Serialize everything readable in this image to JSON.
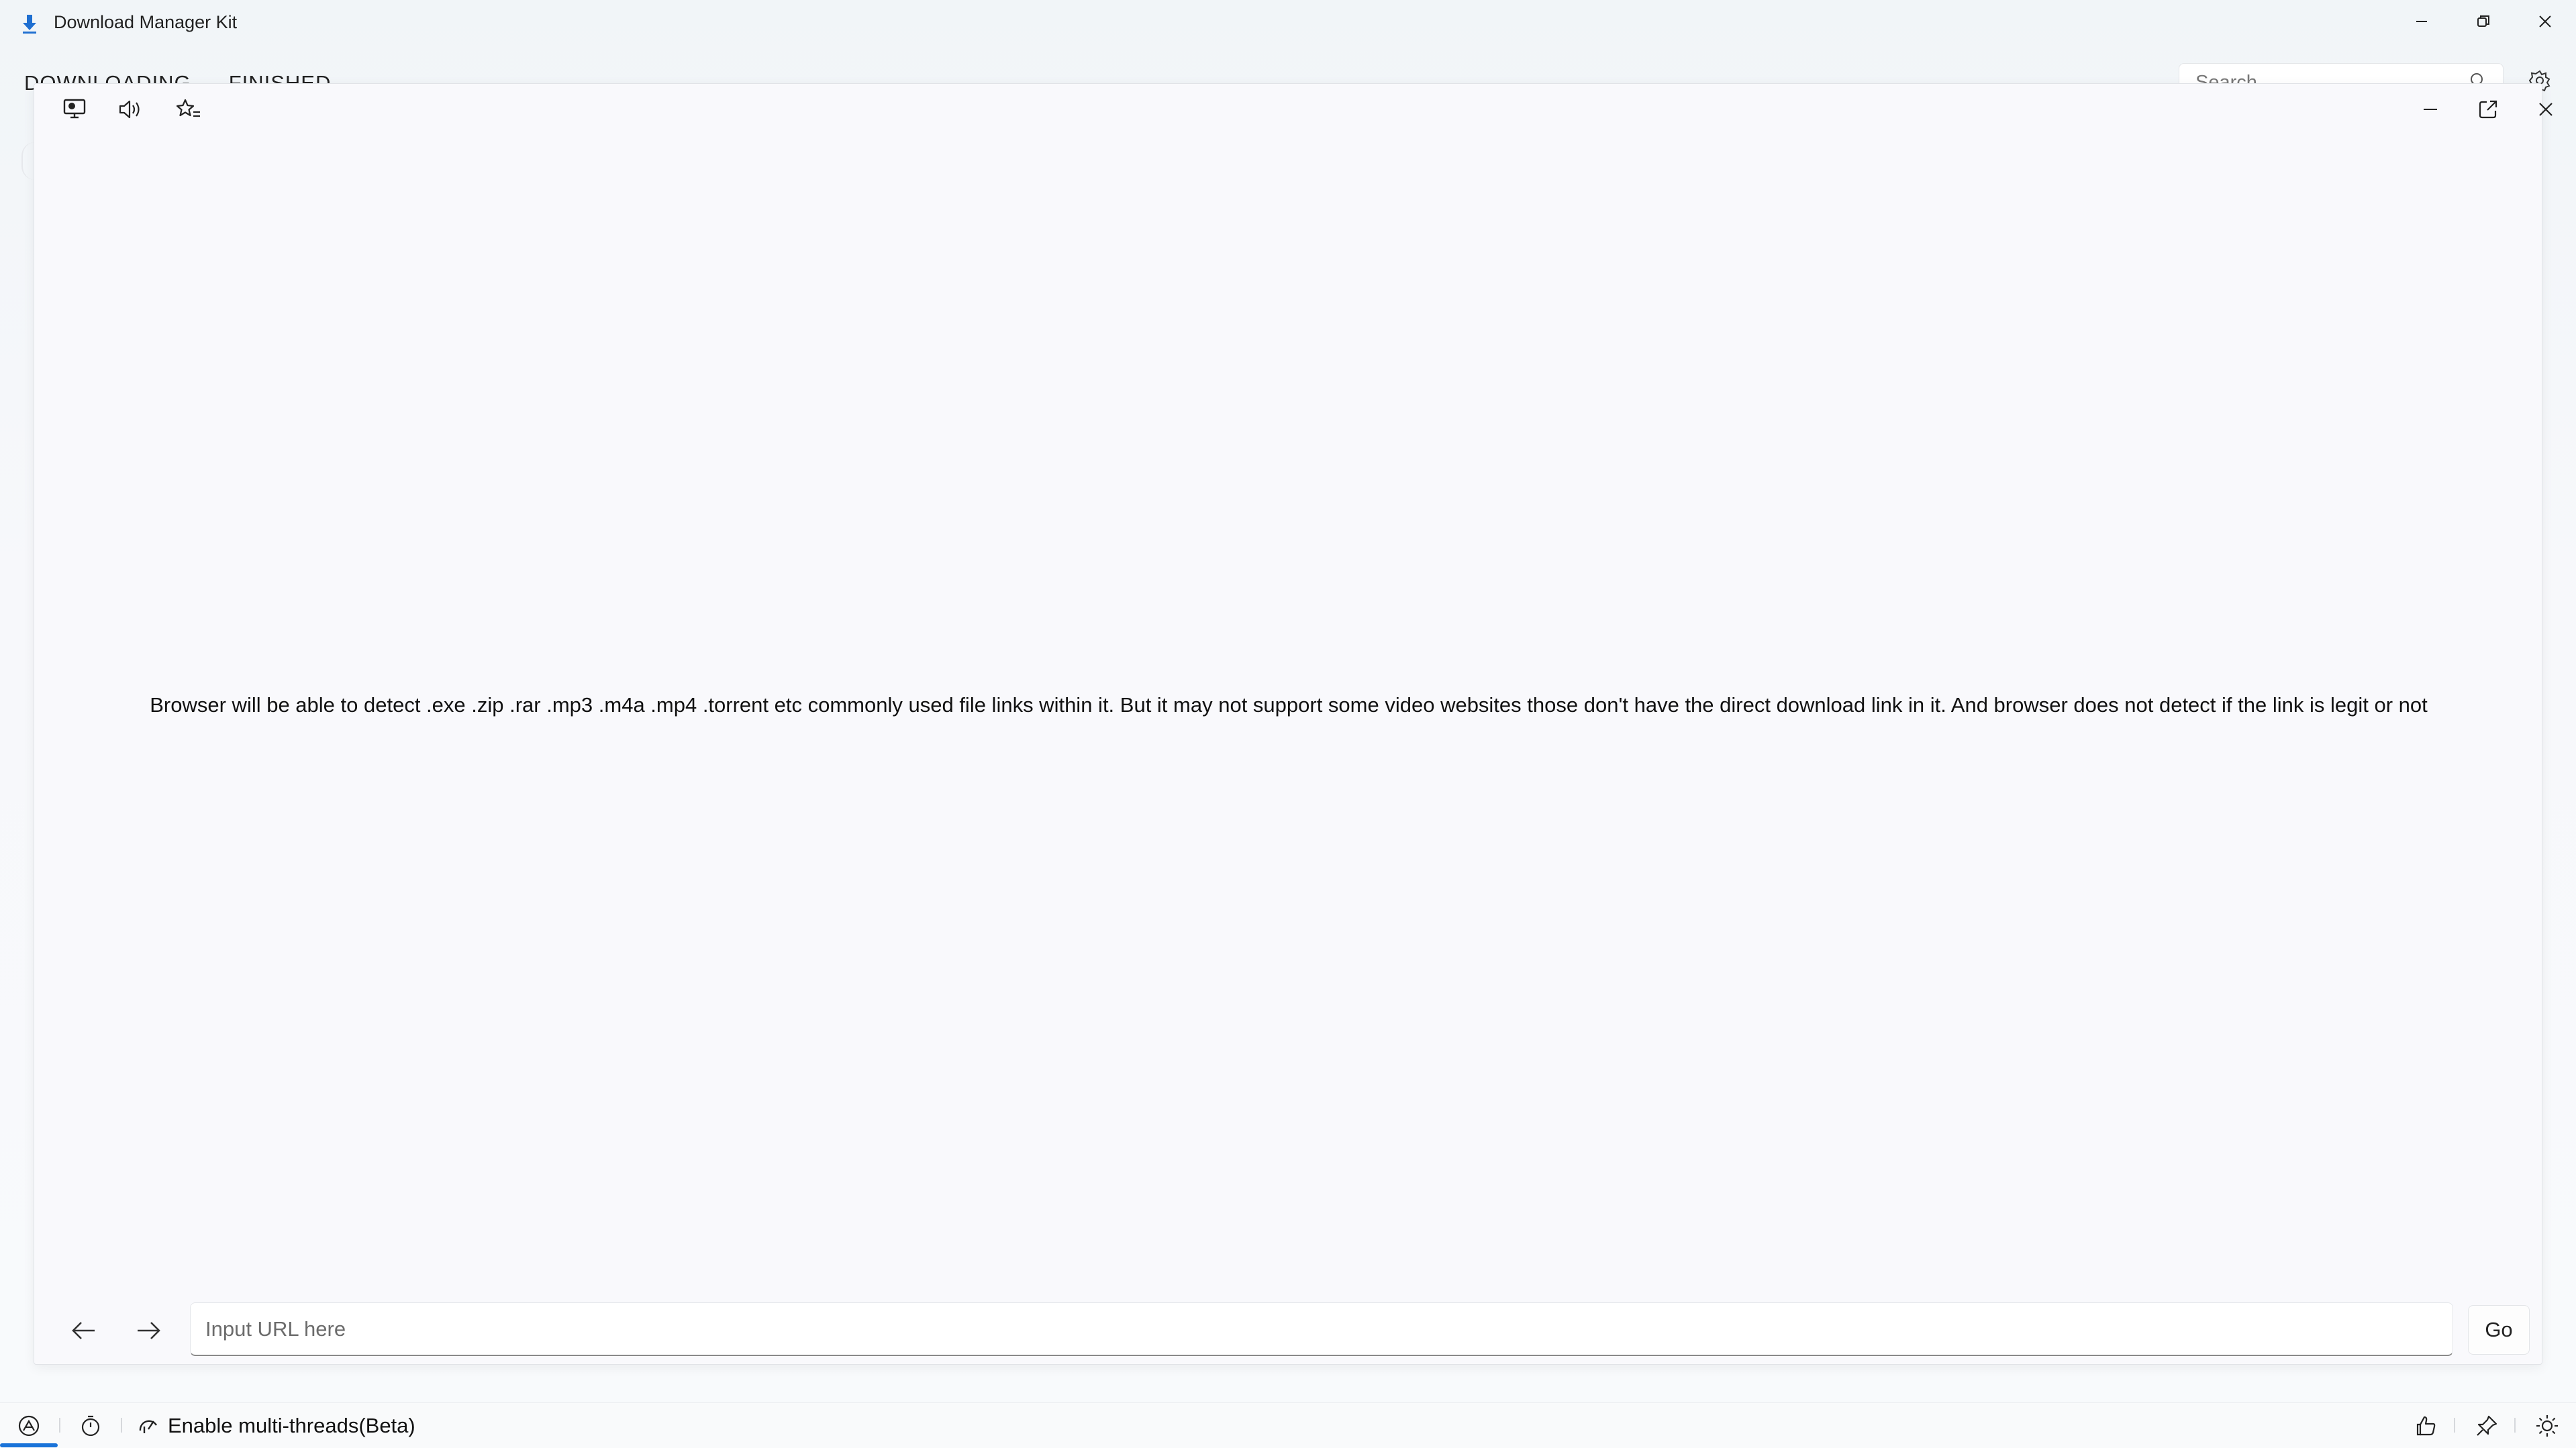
{
  "app": {
    "title": "Download Manager Kit"
  },
  "background": {
    "tabs": [
      "DOWNLOADING",
      "FINISHED"
    ],
    "search_placeholder": "Search"
  },
  "browser": {
    "info_text": "Browser will be able to detect .exe .zip .rar .mp3 .m4a .mp4 .torrent etc commonly used file links within it. But it may not support some video websites those don't have the direct download link in it. And browser does not detect if the link is legit or not",
    "url_placeholder": "Input URL here",
    "url_value": "",
    "go_label": "Go"
  },
  "statusbar": {
    "multithread_label": "Enable multi-threads(Beta)"
  },
  "icons": {
    "app": "download-arrow-icon",
    "desktop": "desktop-icon",
    "sound": "speaker-icon",
    "favorites": "star-list-icon",
    "popout": "open-external-icon",
    "back": "arrow-left-icon",
    "forward": "arrow-right-icon",
    "network": "network-icon",
    "timer": "timer-icon",
    "speed": "speedometer-icon",
    "like": "thumbs-up-icon",
    "pin": "pin-icon",
    "theme": "sun-icon"
  },
  "colors": {
    "accent": "#1a73d9",
    "window_bg": "#f9f9fc"
  }
}
